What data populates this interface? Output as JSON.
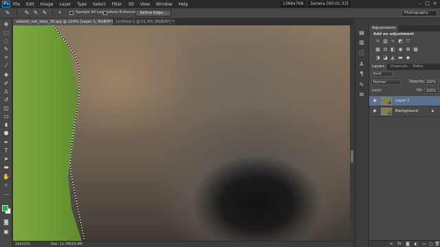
{
  "app": {
    "logo": "Ps"
  },
  "menu": [
    "File",
    "Edit",
    "Image",
    "Layer",
    "Type",
    "Select",
    "Filter",
    "3D",
    "View",
    "Window",
    "Help"
  ],
  "recorder": {
    "resolution": "1366x768",
    "status": "Запись [00:01:33]"
  },
  "window_controls": [
    "minimize-icon",
    "maximize-icon",
    "close-icon"
  ],
  "options": {
    "sample_all_layers": "Sample All Layers",
    "auto_enhance": "Auto-Enhance",
    "refine_edge": "Refine Edge...",
    "workspace": "Photography"
  },
  "tabs": [
    {
      "label": "zabstol_net_deer_16.jpg @ 224% (Layer 1, RGB/8*) *",
      "active": true
    },
    {
      "label": "Untitled-1 @ 51,4% (RGB/8*) *",
      "active": false
    }
  ],
  "status": {
    "zoom": "224,01%",
    "doc": "Doc: 11,7M/23,4M"
  },
  "colors": {
    "foreground": "#1eb035",
    "background": "#ffffff",
    "selected_layer": "#5d6f8e"
  },
  "adjustments": {
    "tab": "Adjustments",
    "title": "Add an adjustment",
    "icons": [
      "brightness-icon",
      "levels-icon",
      "curves-icon",
      "exposure-icon",
      "vibrance-icon",
      "hue-saturation-icon",
      "color-balance-icon",
      "black-white-icon",
      "photo-filter-icon",
      "channel-mixer-icon",
      "color-lookup-icon",
      "invert-icon",
      "posterize-icon",
      "threshold-icon",
      "gradient-map-icon",
      "selective-color-icon"
    ]
  },
  "layers_panel": {
    "tabs": [
      "Layers",
      "Channels",
      "Paths"
    ],
    "filter": "Kind",
    "blend_mode": "Normal",
    "opacity_label": "Opacity:",
    "opacity_value": "100%",
    "lock_label": "Lock:",
    "fill_label": "Fill:",
    "fill_value": "100%",
    "layers": [
      {
        "name": "Layer 1",
        "selected": true,
        "locked": false
      },
      {
        "name": "Background",
        "selected": false,
        "locked": true
      }
    ]
  }
}
